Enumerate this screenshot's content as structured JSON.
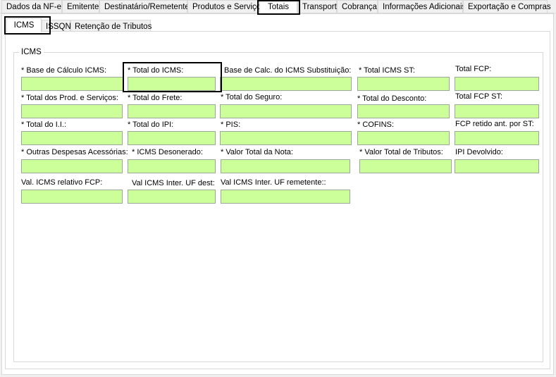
{
  "top_tabs": [
    "Dados da NF-e",
    "Emitente",
    "Destinatário/Remetente",
    "Produtos e Serviços",
    "Totais",
    "Transporte",
    "Cobrança",
    "Informações Adicionais",
    "Exportação e Compras"
  ],
  "active_top_tab": "Totais",
  "sub_tabs": [
    "ICMS",
    "ISSQN",
    "Retenção de Tributos"
  ],
  "active_sub_tab": "ICMS",
  "group_title": "ICMS",
  "fields": {
    "base_calculo_icms": {
      "label": "* Base de Cálculo ICMS:",
      "value": ""
    },
    "total_icms": {
      "label": "* Total do ICMS:",
      "value": ""
    },
    "base_calc_icms_st": {
      "label": "Base de Calc. do ICMS Substituição:",
      "value": ""
    },
    "total_icms_st": {
      "label": "* Total ICMS ST:",
      "value": ""
    },
    "total_fcp": {
      "label": "Total FCP:",
      "value": ""
    },
    "total_prod_servicos": {
      "label": "* Total dos Prod. e Serviços:",
      "value": ""
    },
    "total_frete": {
      "label": "* Total do Frete:",
      "value": ""
    },
    "total_seguro": {
      "label": "* Total do Seguro:",
      "value": ""
    },
    "total_desconto": {
      "label": "* Total do Desconto:",
      "value": ""
    },
    "total_fcp_st": {
      "label": "Total FCP ST:",
      "value": ""
    },
    "total_ii": {
      "label": "* Total do I.I.:",
      "value": ""
    },
    "total_ipi": {
      "label": "* Total do IPI:",
      "value": ""
    },
    "pis": {
      "label": "* PIS:",
      "value": ""
    },
    "cofins": {
      "label": "* COFINS:",
      "value": ""
    },
    "fcp_retido_st": {
      "label": "FCP retido ant. por ST:",
      "value": ""
    },
    "outras_despesas": {
      "label": "* Outras Despesas Acessórias:",
      "value": ""
    },
    "icms_desonerado": {
      "label": "* ICMS Desonerado:",
      "value": ""
    },
    "valor_total_nota": {
      "label": "* Valor Total da Nota:",
      "value": ""
    },
    "valor_total_tributos": {
      "label": "* Valor Total de Tributos:",
      "value": ""
    },
    "ipi_devolvido": {
      "label": "IPI Devolvido:",
      "value": ""
    },
    "val_icms_fcp": {
      "label": "Val. ICMS relativo FCP:",
      "value": ""
    },
    "val_icms_uf_dest": {
      "label": "Val ICMS Inter. UF dest:",
      "value": ""
    },
    "val_icms_uf_remetente": {
      "label": "Val ICMS Inter. UF remetente::",
      "value": ""
    }
  },
  "colors": {
    "field_background": "#ccff99",
    "panel_background": "#ffffff",
    "window_background": "#f0f0f0",
    "highlight_border": "#000000"
  }
}
